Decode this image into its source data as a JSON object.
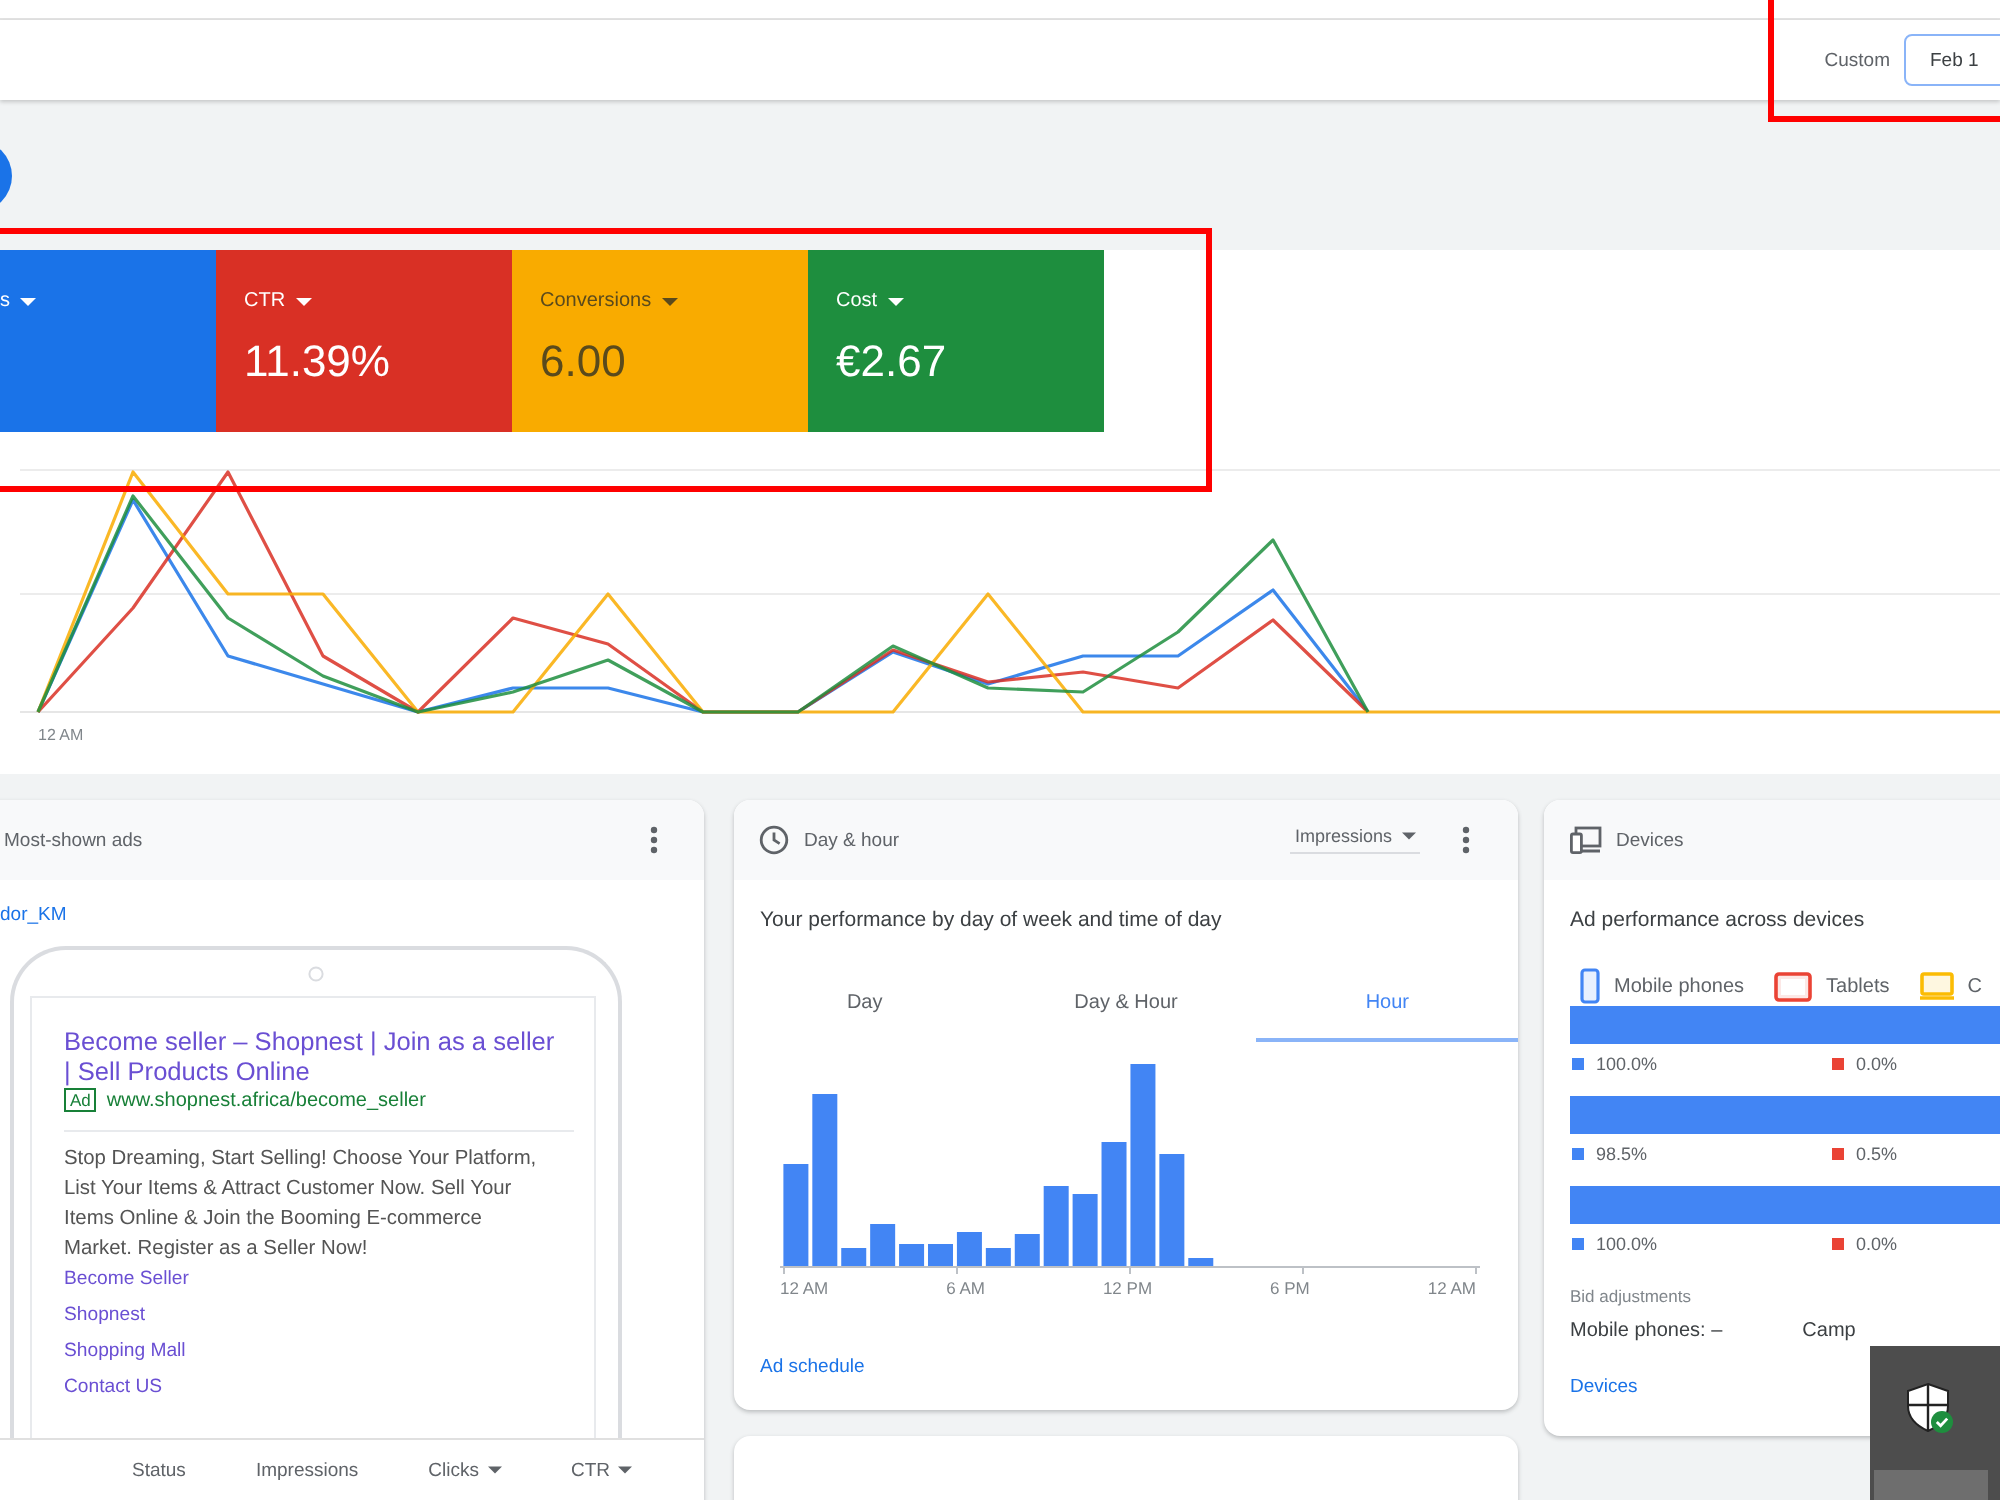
{
  "toolbar": {
    "range_label": "Custom",
    "date_field": {
      "value": "Feb 1"
    }
  },
  "overview": {
    "metrics": [
      {
        "label": "s",
        "color": "#1a73e8"
      },
      {
        "label": "CTR",
        "value": "11.39%",
        "color": "#d93025"
      },
      {
        "label": "Conversions",
        "value": "6.00",
        "color": "#f9ab00"
      },
      {
        "label": "Cost",
        "value": "€2.67",
        "color": "#1e8e3e"
      }
    ],
    "x_labels": [
      "12 AM"
    ]
  },
  "ads_card": {
    "title": "Most-shown ads",
    "account_link": "dor_KM",
    "ad": {
      "headline": "Become seller – Shopnest | Join as a seller | Sell Products Online",
      "badge": "Ad",
      "url": "www.shopnest.africa/become_seller",
      "description": "Stop Dreaming, Start Selling! Choose Your Platform, List Your Items & Attract Customer Now. Sell Your Items Online & Join the Booming E-commerce Market. Register as a Seller Now!",
      "sitelinks": [
        "Become Seller",
        "Shopnest",
        "Shopping Mall",
        "Contact US"
      ]
    },
    "columns": [
      {
        "label": "Status",
        "menu": false
      },
      {
        "label": "Impressions",
        "menu": false
      },
      {
        "label": "Clicks",
        "menu": true
      },
      {
        "label": "CTR",
        "menu": true
      }
    ]
  },
  "schedule_card": {
    "title": "Day & hour",
    "metric_select": "Impressions",
    "subtitle": "Your performance by day of week and time of day",
    "tabs": [
      {
        "label": "Day",
        "selected": false
      },
      {
        "label": "Day & Hour",
        "selected": false
      },
      {
        "label": "Hour",
        "selected": true
      }
    ],
    "axis_labels": [
      "12 AM",
      "6 AM",
      "12 PM",
      "6 PM",
      "12 AM"
    ],
    "link": "Ad schedule"
  },
  "devices_card": {
    "title": "Devices",
    "subtitle": "Ad performance across devices",
    "legend": [
      {
        "label": "Mobile phones",
        "kind": "phone",
        "color": "#4285f4"
      },
      {
        "label": "Tablets",
        "kind": "tablet",
        "color": "#ea4335"
      },
      {
        "label": "C",
        "kind": "computer",
        "color": "#fbbc04"
      }
    ],
    "rows": [
      {
        "readings": [
          "100.0%",
          "0.0%"
        ]
      },
      {
        "readings": [
          "98.5%",
          "0.5%"
        ]
      },
      {
        "readings": [
          "100.0%",
          "0.0%"
        ]
      }
    ],
    "bid_label": "Bid adjustments",
    "bid_values": [
      "Mobile phones: –",
      "Camp"
    ],
    "link": "Devices"
  }
}
